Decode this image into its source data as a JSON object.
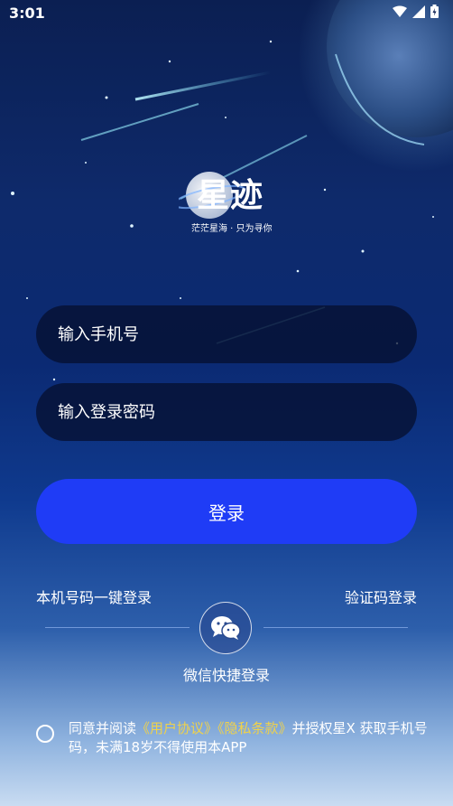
{
  "status_bar": {
    "time": "3:01",
    "icons": [
      "wifi-icon",
      "signal-icon",
      "battery-icon"
    ]
  },
  "logo": {
    "title": "星迹",
    "slogan": "茫茫星海 · 只为寻你"
  },
  "form": {
    "phone_placeholder": "输入手机号",
    "password_placeholder": "输入登录密码",
    "login_label": "登录"
  },
  "links": {
    "one_click_login": "本机号码一键登录",
    "code_login": "验证码登录"
  },
  "wechat": {
    "label": "微信快捷登录",
    "icon": "wechat-icon"
  },
  "agreement": {
    "prefix": "同意并阅读",
    "user_agreement": "《用户协议》",
    "privacy_policy": "《隐私条款》",
    "suffix": "并授权星X 获取手机号码，未满18岁不得使用本APP"
  },
  "colors": {
    "accent": "#1f3cf6",
    "link_highlight": "#f0d24a",
    "background_top": "#0b1f52",
    "background_bottom": "#c9dcf2"
  }
}
